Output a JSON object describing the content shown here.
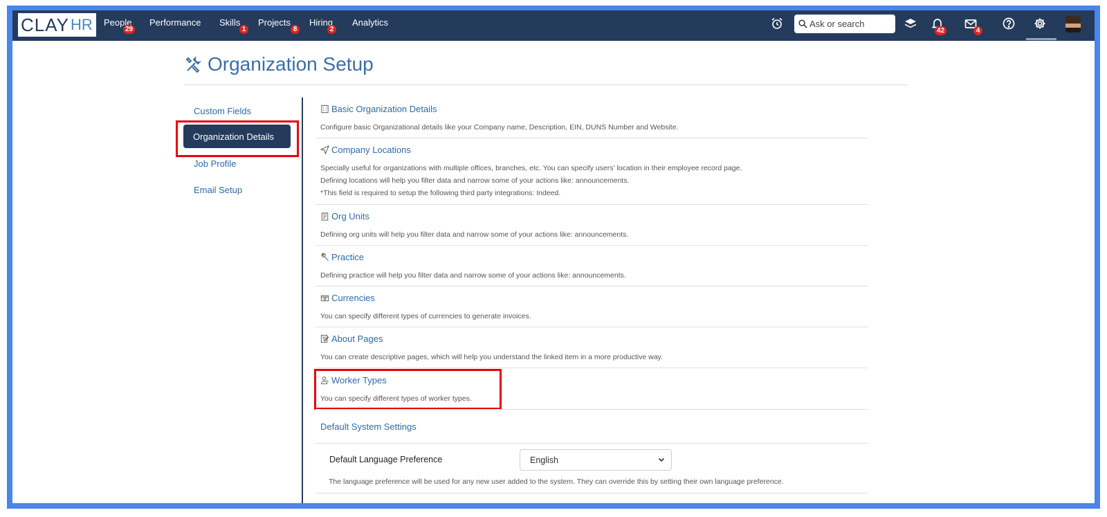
{
  "topbar": {
    "logo": {
      "clay": "CLAY",
      "hr": "HR"
    },
    "nav": [
      {
        "label": "People",
        "badge": "29"
      },
      {
        "label": "Performance",
        "badge": ""
      },
      {
        "label": "Skills",
        "badge": "1"
      },
      {
        "label": "Projects",
        "badge": "8"
      },
      {
        "label": "Hiring",
        "badge": "2"
      },
      {
        "label": "Analytics",
        "badge": ""
      }
    ],
    "search_placeholder": "Ask or search",
    "notifications_badge": "42",
    "messages_badge": "4"
  },
  "page": {
    "title": "Organization Setup"
  },
  "sidebar": {
    "items": [
      {
        "label": "Custom Fields"
      },
      {
        "label": "Organization Details"
      },
      {
        "label": "Job Profile"
      },
      {
        "label": "Email Setup"
      }
    ],
    "active_index": 1
  },
  "sections": [
    {
      "title": "Basic Organization Details",
      "icon": "building-icon",
      "desc": [
        "Configure basic Organizational details like your Company name, Description, EIN, DUNS Number and Website."
      ]
    },
    {
      "title": "Company Locations",
      "icon": "location-arrow-icon",
      "desc": [
        "Specially useful for organizations with multiple offices, branches, etc. You can specify users' location in their employee record page.",
        "Defining locations will help you filter data and narrow some of your actions like: announcements.",
        "*This field is required to setup the following third party integrations: Indeed."
      ]
    },
    {
      "title": "Org Units",
      "icon": "org-units-icon",
      "desc": [
        "Defining org units will help you filter data and narrow some of your actions like: announcements."
      ]
    },
    {
      "title": "Practice",
      "icon": "wrench-icon",
      "desc": [
        "Defining practice will help you filter data and narrow some of your actions like: announcements."
      ]
    },
    {
      "title": "Currencies",
      "icon": "currency-icon",
      "desc": [
        "You can specify different types of currencies to generate invoices."
      ]
    },
    {
      "title": "About Pages",
      "icon": "edit-page-icon",
      "desc": [
        "You can create descriptive pages, which will help you understand the linked item in a more productive way."
      ]
    },
    {
      "title": "Worker Types",
      "icon": "worker-icon",
      "desc": [
        "You can specify different types of worker types."
      ]
    }
  ],
  "default_settings": {
    "title": "Default System Settings",
    "language_label": "Default Language Preference",
    "language_value": "English",
    "language_desc": "The language preference will be used for any new user added to the system. They can override this by setting their own language preference."
  },
  "colors": {
    "nav_bg": "#243b5c",
    "link": "#2d6aa6",
    "highlight": "#e8000b",
    "frame": "#4a86e8",
    "badge": "#e02424"
  }
}
